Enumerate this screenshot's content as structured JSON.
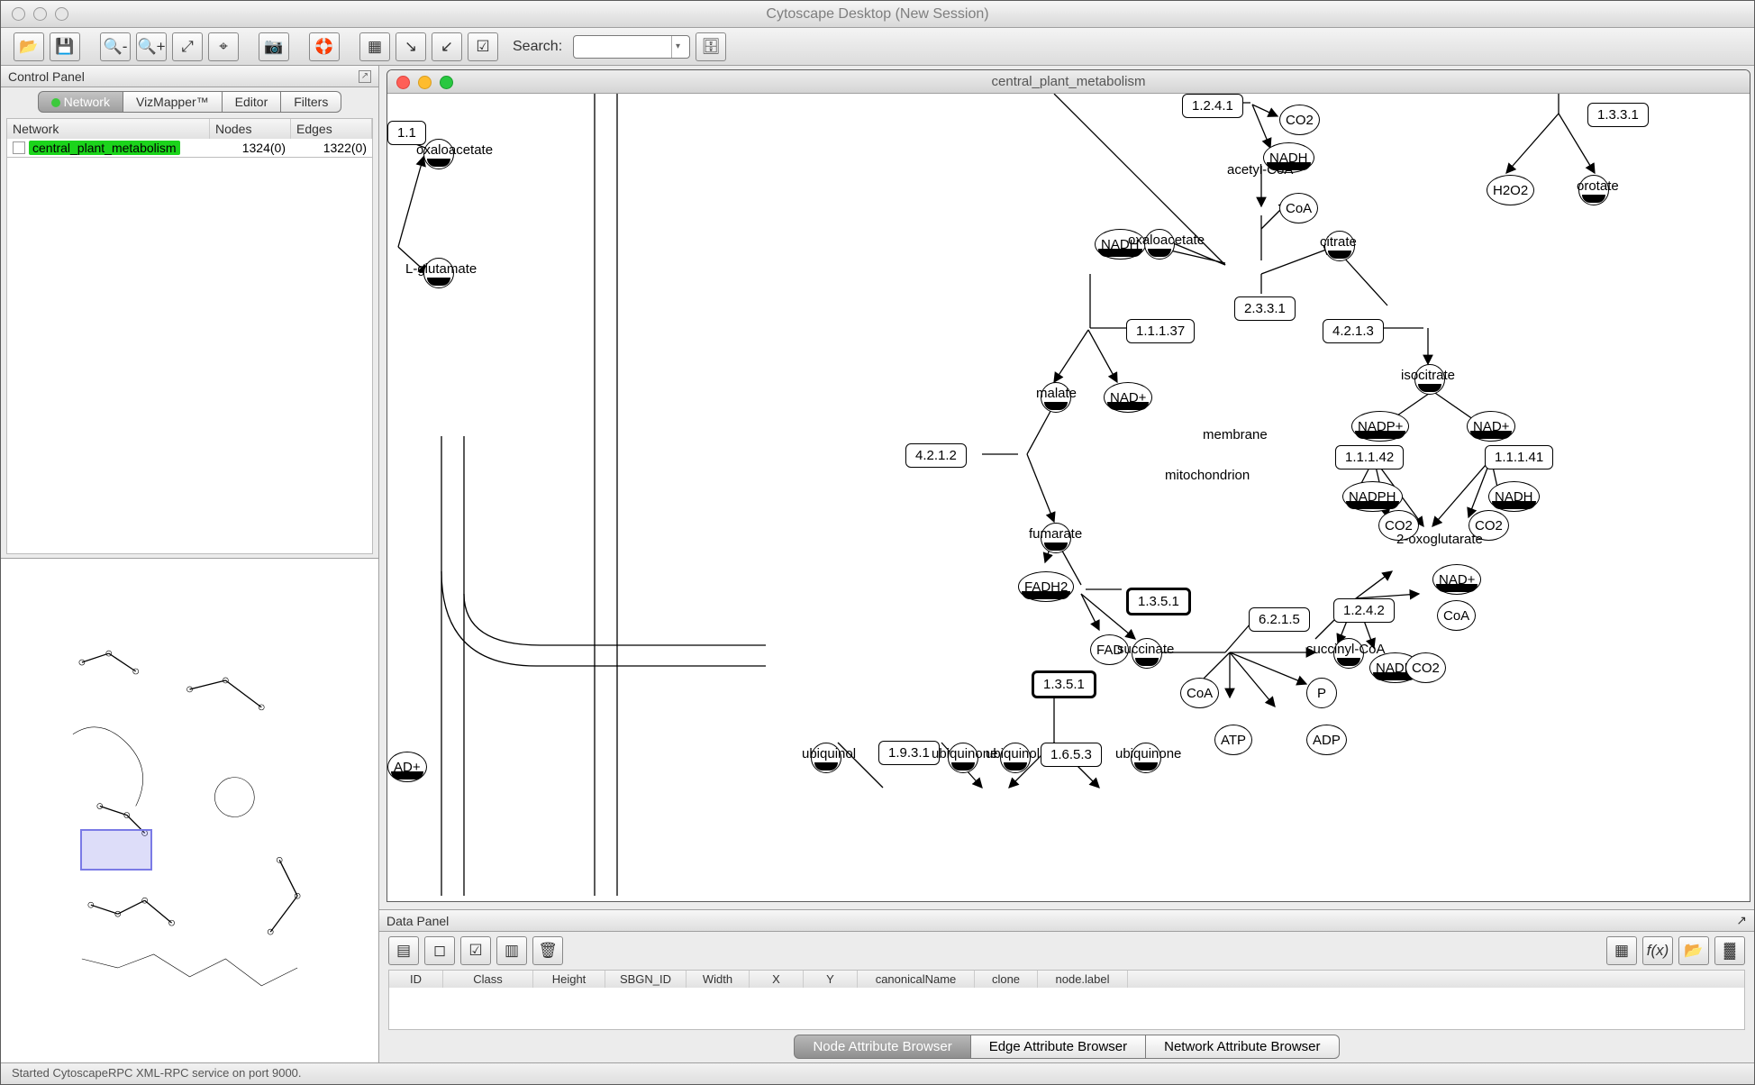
{
  "window_title": "Cytoscape Desktop (New Session)",
  "toolbar": {
    "search_label": "Search:",
    "search_value": ""
  },
  "control_panel": {
    "title": "Control Panel",
    "tabs": [
      "Network",
      "VizMapper™",
      "Editor",
      "Filters"
    ],
    "active_tab": 0,
    "columns": [
      "Network",
      "Nodes",
      "Edges"
    ],
    "rows": [
      {
        "name": "central_plant_metabolism",
        "nodes": "1324(0)",
        "edges": "1322(0)"
      }
    ]
  },
  "network_view": {
    "title": "central_plant_metabolism"
  },
  "graph_labels": {
    "eleven": "1.1",
    "oxaloacetate1": "oxaloacetate",
    "lglut": "L-glutamate",
    "n1241": "1.2.4.1",
    "co2_a": "CO2",
    "nadh_a": "NADH",
    "acoA": "acetyl-CoA",
    "n1331": "1.3.3.1",
    "h2o2": "H2O2",
    "orotate": "orotate",
    "coa_a": "CoA",
    "nadh_b": "NADH",
    "oxaloacetate2": "oxaloacetate",
    "n2331": "2.3.3.1",
    "citrate": "citrate",
    "n11137": "1.1.1.37",
    "n4213": "4.2.1.3",
    "malate": "malate",
    "nadp_a": "NAD+",
    "isocitrate": "isocitrate",
    "membrane": "membrane",
    "mito": "mitochondrion",
    "n4212": "4.2.1.2",
    "nadpplus": "NADP+",
    "nadplus_r": "NAD+",
    "n11142": "1.1.1.42",
    "n11141": "1.1.1.41",
    "nadph": "NADPH",
    "nadh_r": "NADH",
    "co2_l": "CO2",
    "co2_r": "CO2",
    "twooxo": "2-oxoglutarate",
    "fumarate": "fumarate",
    "fadh2": "FADH2",
    "n1351a": "1.3.5.1",
    "n1351b": "1.3.5.1",
    "nadplus_b": "NAD+",
    "coa_b": "CoA",
    "n1242": "1.2.4.2",
    "fad": "FAD",
    "succinate": "succinate",
    "n6215": "6.2.1.5",
    "succoa": "succinyl-CoA",
    "nadh_c": "NADH",
    "co2_c": "CO2",
    "coa_c": "CoA",
    "p": "P",
    "atp": "ATP",
    "adp": "ADP",
    "n1931": "1.9.3.1",
    "ubiq1": "ubiquinol",
    "ubiqn1": "ubiquinone",
    "ubiq2": "ubiquinol",
    "n1653": "1.6.5.3",
    "ubiqn2": "ubiquinone",
    "adplus": "AD+"
  },
  "data_panel": {
    "title": "Data Panel",
    "columns": [
      "ID",
      "Class",
      "Height",
      "SBGN_ID",
      "Width",
      "X",
      "Y",
      "canonicalName",
      "clone",
      "node.label"
    ],
    "tabs": [
      "Node Attribute Browser",
      "Edge Attribute Browser",
      "Network Attribute Browser"
    ],
    "active_tab": 0
  },
  "status": "Started CytoscapeRPC XML-RPC service on port 9000."
}
